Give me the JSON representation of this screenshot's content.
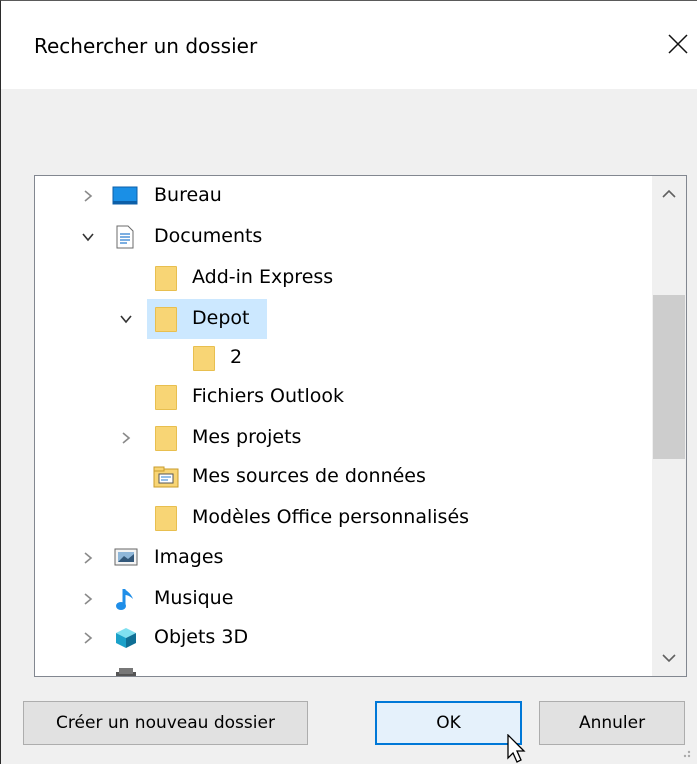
{
  "dialog": {
    "title": "Rechercher un dossier",
    "close_icon": "close-icon"
  },
  "tree": {
    "items": [
      {
        "label": "Bureau",
        "icon": "desktop-icon",
        "expander": "collapsed"
      },
      {
        "label": "Documents",
        "icon": "documents-icon",
        "expander": "expanded"
      },
      {
        "label": "Add-in Express",
        "icon": "folder-icon",
        "expander": "none"
      },
      {
        "label": "Depot",
        "icon": "folder-icon",
        "expander": "expanded",
        "selected": true
      },
      {
        "label": "2",
        "icon": "folder-icon",
        "expander": "none"
      },
      {
        "label": "Fichiers Outlook",
        "icon": "folder-icon",
        "expander": "none"
      },
      {
        "label": "Mes projets",
        "icon": "folder-icon",
        "expander": "collapsed"
      },
      {
        "label": "Mes sources de données",
        "icon": "data-sources-folder-icon",
        "expander": "none"
      },
      {
        "label": "Modèles Office personnalisés",
        "icon": "folder-icon",
        "expander": "none"
      },
      {
        "label": "Images",
        "icon": "images-icon",
        "expander": "collapsed"
      },
      {
        "label": "Musique",
        "icon": "music-icon",
        "expander": "collapsed"
      },
      {
        "label": "Objets 3D",
        "icon": "3d-objects-icon",
        "expander": "collapsed"
      }
    ]
  },
  "buttons": {
    "new_folder": "Créer un nouveau dossier",
    "ok": "OK",
    "cancel": "Annuler"
  },
  "colors": {
    "accent": "#0078d7",
    "selection": "#cce8ff",
    "folder": "#f8d575"
  }
}
